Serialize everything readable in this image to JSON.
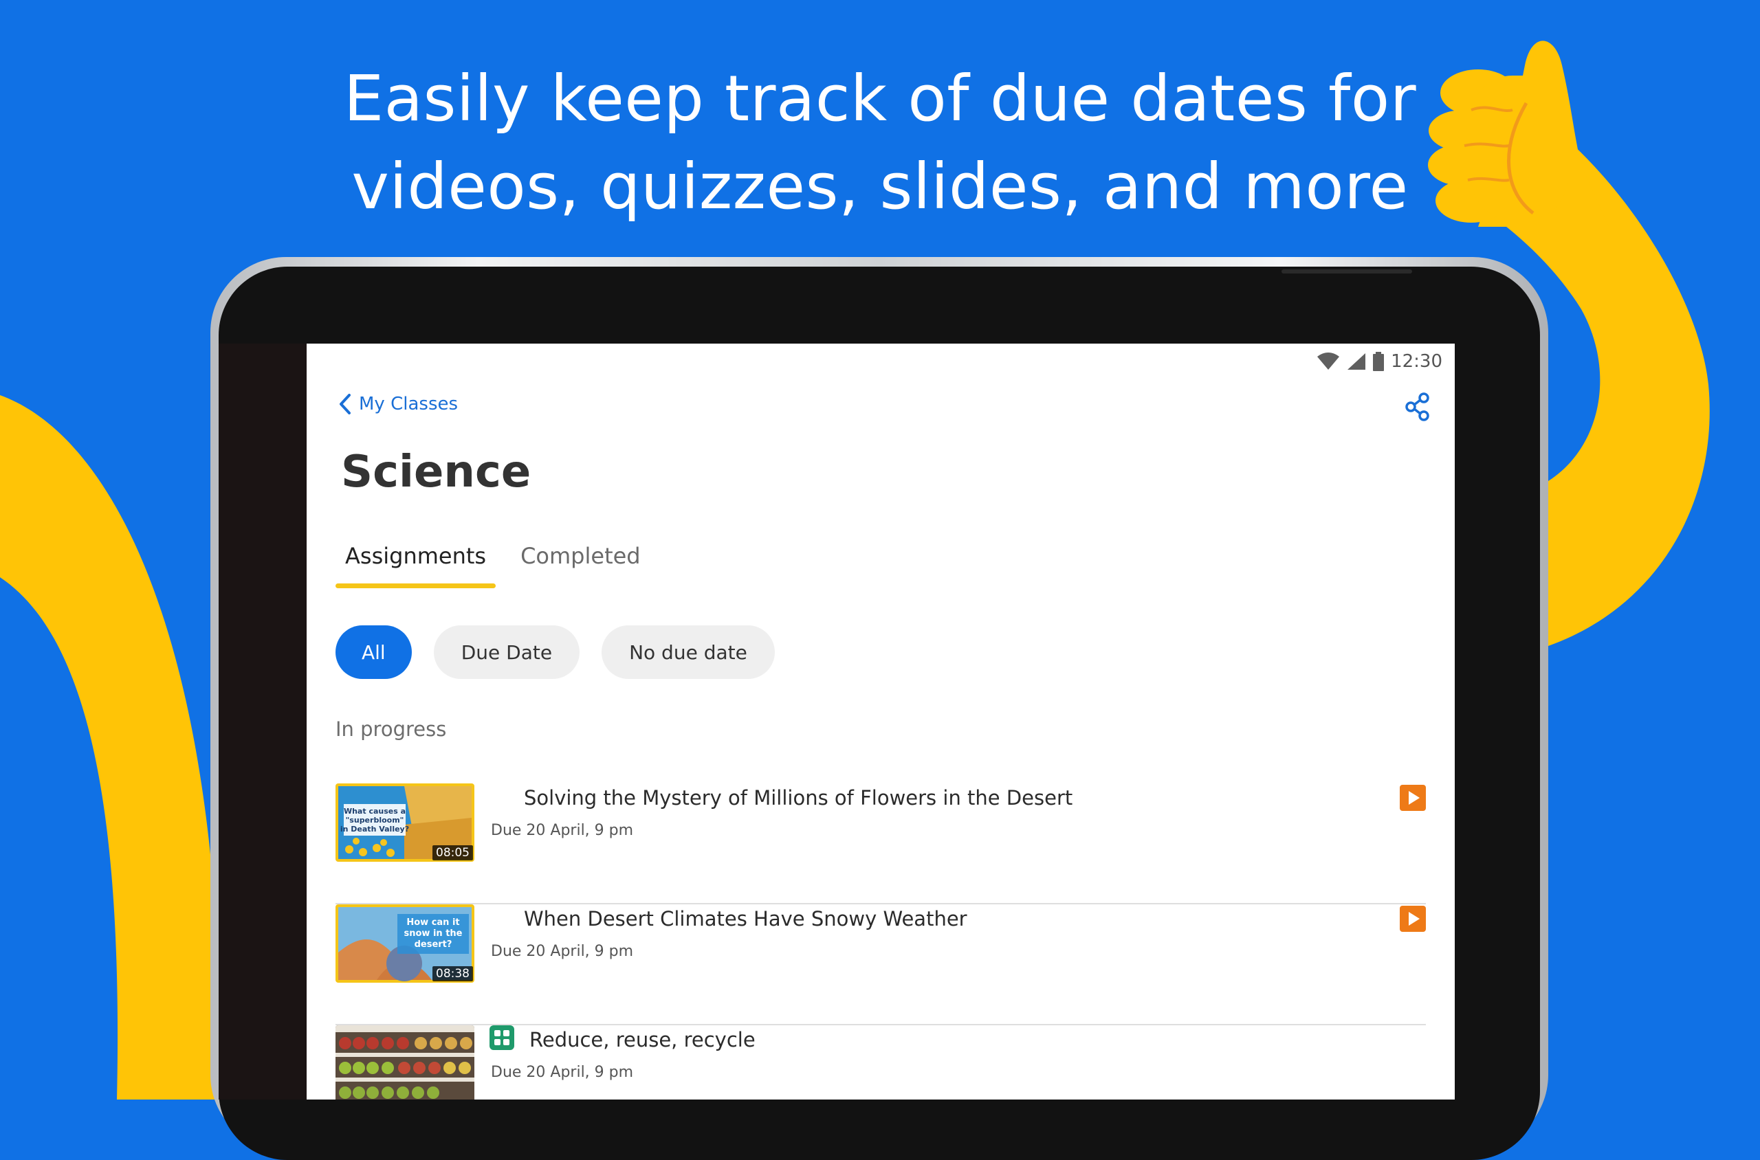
{
  "headline": {
    "line1": "Easily keep track of due dates for",
    "line2": "videos, quizzes, slides, and more"
  },
  "status_bar": {
    "time": "12:30",
    "icons": [
      "wifi-icon",
      "cellular-signal-icon",
      "battery-icon"
    ]
  },
  "nav": {
    "back_label": "My Classes",
    "back_icon": "chevron-left-icon",
    "share_icon": "share-icon"
  },
  "page": {
    "title": "Science"
  },
  "tabs": [
    {
      "label": "Assignments",
      "active": true
    },
    {
      "label": "Completed",
      "active": false
    }
  ],
  "filters": [
    {
      "label": "All",
      "active": true
    },
    {
      "label": "Due Date",
      "active": false
    },
    {
      "label": "No due date",
      "active": false
    }
  ],
  "section": {
    "label": "In progress"
  },
  "assignments": [
    {
      "title": "Solving the Mystery of Millions of Flowers in the Desert",
      "due": "Due 20 April, 9 pm",
      "duration": "08:05",
      "thumb_text": [
        "What causes a",
        "\"superbloom\"",
        "in Death Valley?"
      ],
      "type_icon": "video-play-icon"
    },
    {
      "title": "When Desert Climates Have Snowy Weather",
      "due": "Due 20 April, 9 pm",
      "duration": "08:38",
      "thumb_text": [
        "How can it",
        "snow in the",
        "desert?"
      ],
      "type_icon": "video-play-icon"
    },
    {
      "title": "Reduce, reuse, recycle",
      "due": "Due 20 April, 9 pm",
      "type_icon": "slides-icon"
    }
  ],
  "colors": {
    "background": "#1071e5",
    "accent_yellow": "#f5c518",
    "link_blue": "#1a6fd6",
    "video_orange": "#ee7a17",
    "slides_green": "#1f9a6b"
  }
}
